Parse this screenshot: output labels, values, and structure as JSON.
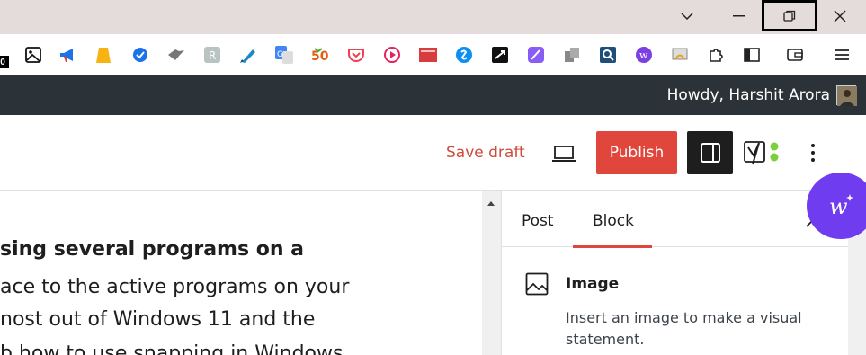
{
  "browser": {
    "window_controls": {
      "minimize": "minimize-icon",
      "restore": "restore-icon",
      "close": "close-icon"
    },
    "tab_search_icon": "chevron-down-icon",
    "extension_badge": "0"
  },
  "wp_admin_bar": {
    "howdy": "Howdy, Harshit Arora"
  },
  "editor_header": {
    "save_draft": "Save draft",
    "publish": "Publish"
  },
  "content": {
    "lines": [
      "sing several programs on a",
      "ace to the active programs on your",
      "nost out of Windows 11 and the",
      "b how to use snapping in Windows"
    ]
  },
  "sidebar": {
    "tabs": [
      "Post",
      "Block"
    ],
    "active_tab": "Block",
    "block": {
      "title": "Image",
      "description": "Insert an image to make a visual statement."
    }
  },
  "colors": {
    "publish": "#e0463c",
    "admin_bar": "#2c3338",
    "fab": "#6f3cf0",
    "save_draft": "#cc4c3b"
  }
}
